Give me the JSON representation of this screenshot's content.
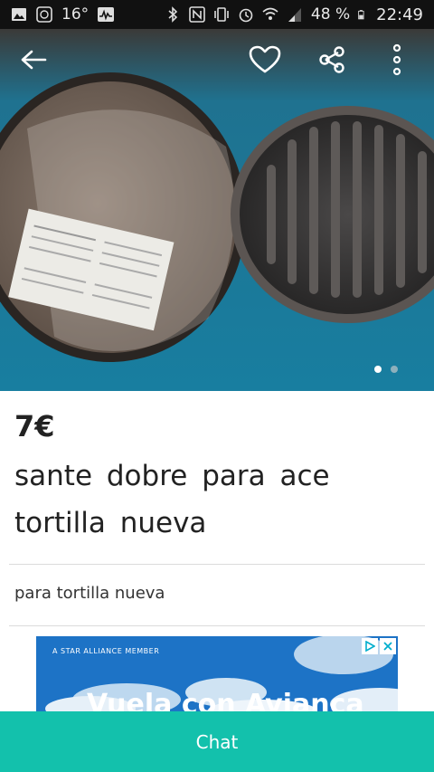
{
  "status_bar": {
    "temperature": "16°",
    "battery": "48 %",
    "time": "22:49",
    "icons": [
      "gallery-icon",
      "notification-icon",
      "activity-icon",
      "bluetooth-icon",
      "nfc-icon",
      "vibrate-icon",
      "alarm-icon",
      "wifi-icon",
      "signal-icon",
      "battery-icon"
    ]
  },
  "toolbar": {
    "icons": [
      "back-arrow-icon",
      "heart-icon",
      "share-icon",
      "more-options-icon"
    ]
  },
  "gallery": {
    "image_count": 2,
    "active_index": 0
  },
  "item": {
    "price": "7€",
    "title": "sante  dobre  para ace tortilla  nueva",
    "description": "para tortilla  nueva"
  },
  "ad": {
    "alliance_text": "A STAR ALLIANCE MEMBER",
    "headline": "Vuela con Avianca",
    "icons": [
      "adchoices-icon",
      "close-icon"
    ]
  },
  "chat": {
    "label": "Chat"
  },
  "colors": {
    "accent": "#13c1ac",
    "ad_background": "#1d73c6"
  }
}
